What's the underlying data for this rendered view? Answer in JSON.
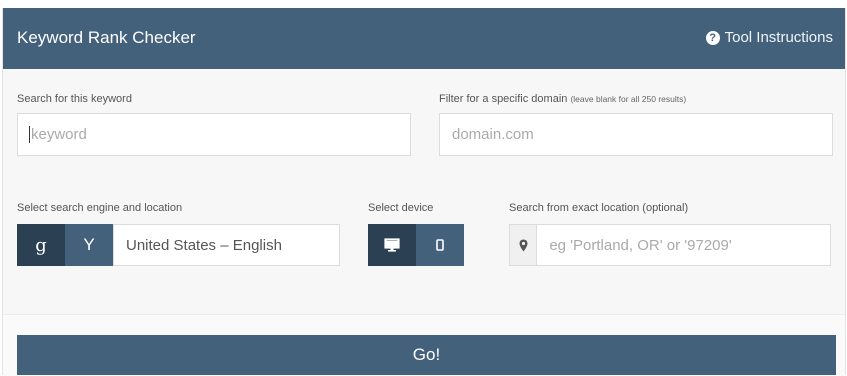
{
  "header": {
    "title": "Keyword Rank Checker",
    "instructions_label": "Tool Instructions",
    "help_icon_glyph": "?"
  },
  "keyword": {
    "label": "Search for this keyword",
    "placeholder": "keyword"
  },
  "domain": {
    "label": "Filter for a specific domain",
    "hint": "(leave blank for all 250 results)",
    "placeholder": "domain.com"
  },
  "engine": {
    "label": "Select search engine and location",
    "google_glyph": "g",
    "yahoo_glyph": "Y",
    "location_value": "United States – English"
  },
  "device": {
    "label": "Select device",
    "options": [
      "desktop",
      "mobile"
    ],
    "selected": "desktop"
  },
  "exact_location": {
    "label": "Search from exact location (optional)",
    "placeholder": "eg 'Portland, OR' or '97209'"
  },
  "go_label": "Go!",
  "colors": {
    "header": "#44617b",
    "engine_selected": "#2c4054",
    "engine_unselected": "#44617b",
    "panel": "#f7f7f7"
  }
}
